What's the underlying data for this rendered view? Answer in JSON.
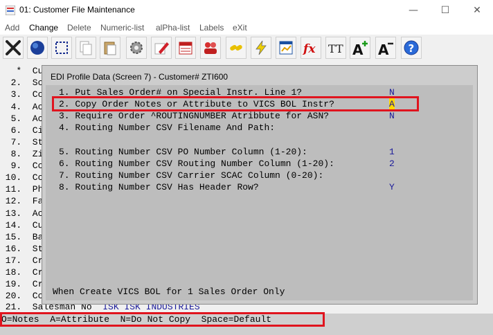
{
  "window": {
    "title": "01: Customer File Maintenance",
    "minimize": "—",
    "maximize": "☐",
    "close": "✕"
  },
  "menu": [
    {
      "label": "Add"
    },
    {
      "label": "Change"
    },
    {
      "label": "Delete"
    },
    {
      "label": "Numeric-list"
    },
    {
      "label": "alPha-list"
    },
    {
      "label": "Labels"
    },
    {
      "label": "eXit"
    }
  ],
  "toolbar_icons": [
    "tools-icon",
    "globe-icon",
    "select-icon",
    "copy-icon",
    "paste-icon",
    "settings-icon",
    "edit-icon",
    "calendar-icon",
    "users-icon",
    "link-icon",
    "lightning-icon",
    "report-icon",
    "function-icon",
    "font-icon",
    "font-increase-icon",
    "font-decrease-icon",
    "help-icon"
  ],
  "toolbar_text": {
    "function": "fx",
    "font": "TT",
    "font_increase": "A",
    "font_decrease": "A",
    "help": "?"
  },
  "background_lines": [
    {
      "text": "   *  Cu"
    },
    {
      "text": "  2.  Sc"
    },
    {
      "text": "  3.  Cc"
    },
    {
      "text": "  4.  Ac"
    },
    {
      "text": "  5.  Ac"
    },
    {
      "text": "  6.  Ci"
    },
    {
      "text": "  7.  St"
    },
    {
      "text": "  8.  Zi"
    },
    {
      "text": "  9.  Cc"
    },
    {
      "text": " 10.  Cc"
    },
    {
      "text": " 11.  Ph"
    },
    {
      "text": " 12.  Fa"
    },
    {
      "text": " 13.  Ac"
    },
    {
      "text": " 14.  Cu"
    },
    {
      "text": " 15.  Ba"
    },
    {
      "text": " 16.  St"
    },
    {
      "text": " 17.  Cr"
    },
    {
      "text": " 18.  Cr"
    },
    {
      "text": " 19.  Cr"
    },
    {
      "text": " 20.  Cc"
    }
  ],
  "salesman_line": {
    "label": " 21.  Salesman No",
    "value": "ISK ISK INDUSTRIES"
  },
  "dialog": {
    "title": "EDI Profile Data (Screen 7) - Customer# ZTI600",
    "items": [
      {
        "label": "1. Put Sales Order# on Special Instr. Line 1?",
        "value": "N"
      },
      {
        "label": "2. Copy Order Notes or Attribute to VICS BOL Instr?",
        "value": "A"
      },
      {
        "label": "3. Require Order ^ROUTINGNUMBER Atribbute for ASN?",
        "value": "N"
      },
      {
        "label": "4. Routing Number CSV Filename And Path:",
        "value": ""
      },
      {
        "label": "5. Routing Number CSV PO Number Column (1-20):",
        "value": "1"
      },
      {
        "label": "6. Routing Number CSV Routing Number Column (1-20):",
        "value": "2"
      },
      {
        "label": "7. Routing Number CSV Carrier SCAC Column (0-20):",
        "value": ""
      },
      {
        "label": "8. Routing Number CSV Has Header Row?",
        "value": "Y"
      }
    ],
    "hint": "When Create VICS BOL for 1 Sales Order Only"
  },
  "status": {
    "text": "O=Notes  A=Attribute  N=Do Not Copy  Space=Default"
  },
  "colors": {
    "highlight_border": "#e0141e",
    "value_text": "#1a1a9a",
    "cursor": "#ffd800"
  }
}
